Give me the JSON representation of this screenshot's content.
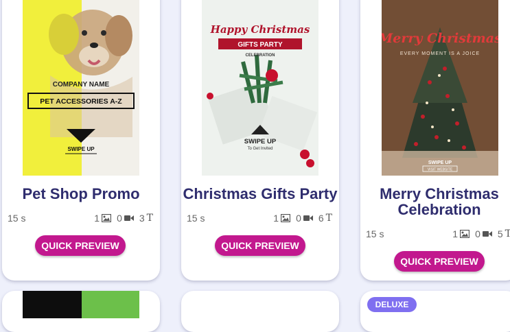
{
  "templates": [
    {
      "title": "Pet Shop Promo",
      "duration": "15 s",
      "image_count": "1",
      "video_count": "0",
      "text_count": "3",
      "button_label": "QUICK PREVIEW",
      "poster": {
        "company": "COMPANY NAME",
        "label": "PET ACCESSORIES A-Z",
        "cta": "SWIPE UP"
      }
    },
    {
      "title": "Christmas Gifts Party",
      "duration": "15 s",
      "image_count": "1",
      "video_count": "0",
      "text_count": "6",
      "button_label": "QUICK PREVIEW",
      "poster": {
        "headline": "Happy Christmas",
        "ribbon": "GIFTS PARTY",
        "sub": "CELEBRATION",
        "cta": "SWIPE UP",
        "cta_sub": "To Get Invited"
      }
    },
    {
      "title": "Merry Christmas Celebration",
      "duration": "15 s",
      "image_count": "1",
      "video_count": "0",
      "text_count": "5",
      "button_label": "QUICK PREVIEW",
      "poster": {
        "headline": "Merry Christmas",
        "sub": "EVERY MOMENT IS A JOICE",
        "cta": "SWIPE UP",
        "cta_sub": "VISIT WEBSITE"
      }
    }
  ],
  "badges": {
    "deluxe": "DELUXE"
  },
  "icons": {
    "image": "image-icon",
    "video": "video-camera-icon",
    "text": "text-icon"
  },
  "colors": {
    "title": "#2f2d6e",
    "button": "#c2188e",
    "badge": "#7f6ff0",
    "background": "#eef0fb"
  }
}
